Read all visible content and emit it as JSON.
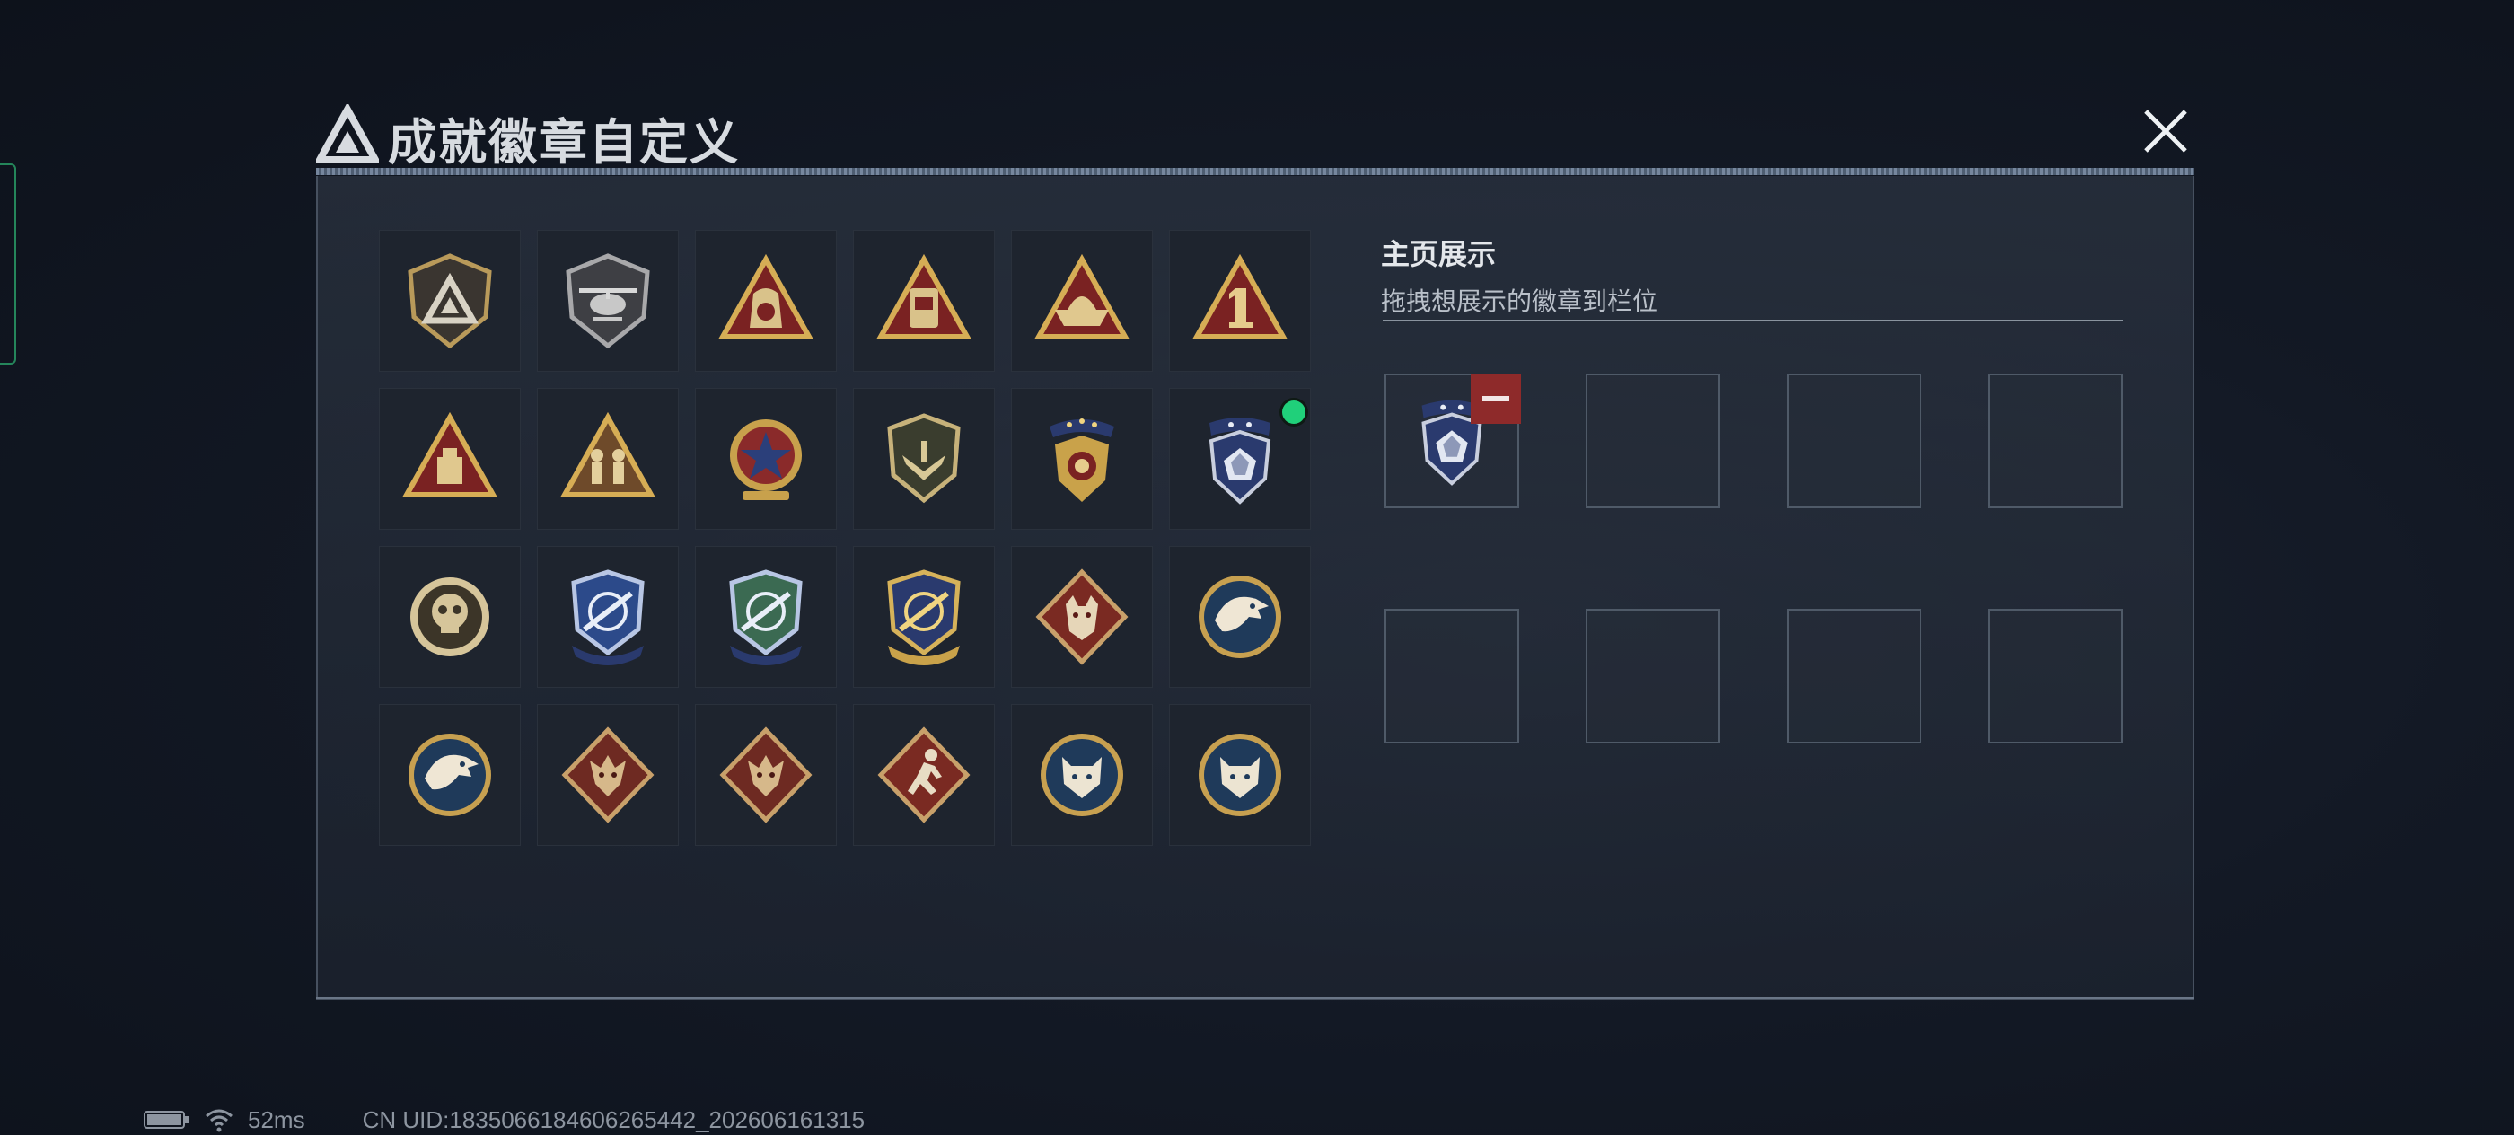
{
  "header": {
    "title": "成就徽章自定义",
    "close_icon": "close-icon"
  },
  "badges": [
    {
      "icon": "delta-logo-shield-badge"
    },
    {
      "icon": "helicopter-shield-badge"
    },
    {
      "icon": "bag-55-triangle-badge"
    },
    {
      "icon": "bag-57-triangle-badge"
    },
    {
      "icon": "ship-triangle-badge"
    },
    {
      "icon": "number-1-triangle-badge"
    },
    {
      "icon": "crate-triangle-badge"
    },
    {
      "icon": "soldiers-triangle-badge"
    },
    {
      "icon": "star-medal-badge"
    },
    {
      "icon": "wings-shield-badge"
    },
    {
      "icon": "gold-stars-shield-badge"
    },
    {
      "icon": "diamond-shield-badge",
      "new": true
    },
    {
      "icon": "skull-crosshair-badge"
    },
    {
      "icon": "rifle-shield-badge-blue"
    },
    {
      "icon": "rifle-shield-badge-green"
    },
    {
      "icon": "rifle-shield-badge-gold"
    },
    {
      "icon": "wolf-diamond-badge"
    },
    {
      "icon": "eagle-round-badge"
    },
    {
      "icon": "eagle-round-badge-2"
    },
    {
      "icon": "dragon-diamond-badge"
    },
    {
      "icon": "dragon-diamond-badge-2"
    },
    {
      "icon": "runner-diamond-badge"
    },
    {
      "icon": "lynx-round-badge"
    },
    {
      "icon": "lynx-round-badge-2"
    }
  ],
  "showcase": {
    "title": "主页展示",
    "subtitle": "拖拽想展示的徽章到栏位",
    "slots": [
      {
        "badge": "diamond-shield-badge",
        "remove_icon": "minus-icon"
      },
      {},
      {},
      {},
      {},
      {},
      {},
      {}
    ]
  },
  "status": {
    "battery_icon": "battery-icon",
    "wifi_icon": "wifi-icon",
    "ping": "52ms",
    "uid": "CN UID:1835066184606265442_202606161315"
  },
  "colors": {
    "accent_new": "#20d07a",
    "remove_red": "#8e2a2a",
    "gold": "#c9a24a",
    "navy": "#2a3a6e"
  }
}
